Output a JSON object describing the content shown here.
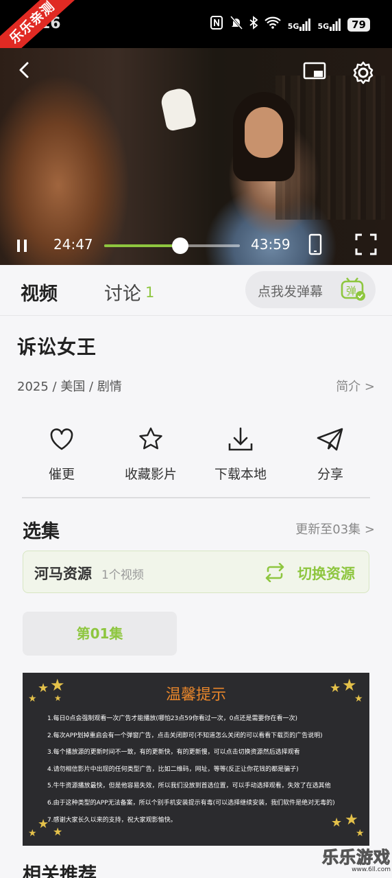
{
  "status_bar": {
    "ribbon": "乐乐亲测",
    "time": "16",
    "signal_1": "5G",
    "signal_2": "5G",
    "battery": "79"
  },
  "player": {
    "current_time": "24:47",
    "duration": "43:59",
    "progress": 0.56
  },
  "tabs": {
    "video": "视频",
    "discussion": "讨论",
    "discussion_count": "1",
    "danmu_placeholder": "点我发弹幕",
    "danmu_icon_char": "弹"
  },
  "show": {
    "title": "诉讼女王",
    "meta": "2025 / 美国 / 剧情",
    "intro_link": "简介 >"
  },
  "actions": [
    {
      "label": "催更",
      "icon": "heart-icon"
    },
    {
      "label": "收藏影片",
      "icon": "star-icon"
    },
    {
      "label": "下载本地",
      "icon": "download-icon"
    },
    {
      "label": "分享",
      "icon": "share-icon"
    }
  ],
  "episodes": {
    "title": "选集",
    "update": "更新至03集 >",
    "source_name": "河马资源",
    "source_count": "1个视频",
    "switch_label": "切换资源",
    "items": [
      "第01集"
    ]
  },
  "notice": {
    "title": "温馨提示",
    "lines": [
      "1.每日0点会强制观看一次广告才能播放(哪怕23点59你看过一次，0点还是需要你在看一次)",
      "2.每次APP划掉重启会有一个弹窗广告，点击关闭即可(不知道怎么关闭的可以看看下载页的广告说明)",
      "3.每个播放源的更新时间不一致，有的更新快，有的更新慢，可以点击切换资源然后选择观看",
      "4.请勿相信影片中出现的任何类型广告，比如二维码，网址，等等(反正让你花钱的都是骗子)",
      "5.牛牛资源播放最快，但是他容易失效，所以我们没放到首选位置，可以手动选择观看，失效了在选其他",
      "6.由于这种类型的APP无法备案，所以个别手机安装提示有毒(可以选择继续安装，我们软件是绝对无毒的)",
      "7.感谢大家长久以来的支持，祝大家观影愉快。"
    ]
  },
  "related": {
    "title": "相关推荐"
  },
  "watermark": {
    "brand": "乐乐游戏",
    "url": "www.6ll.com"
  },
  "colors": {
    "accent": "#8ec63f",
    "ribbon": "#e02a23",
    "notice_title": "#e8862b"
  }
}
